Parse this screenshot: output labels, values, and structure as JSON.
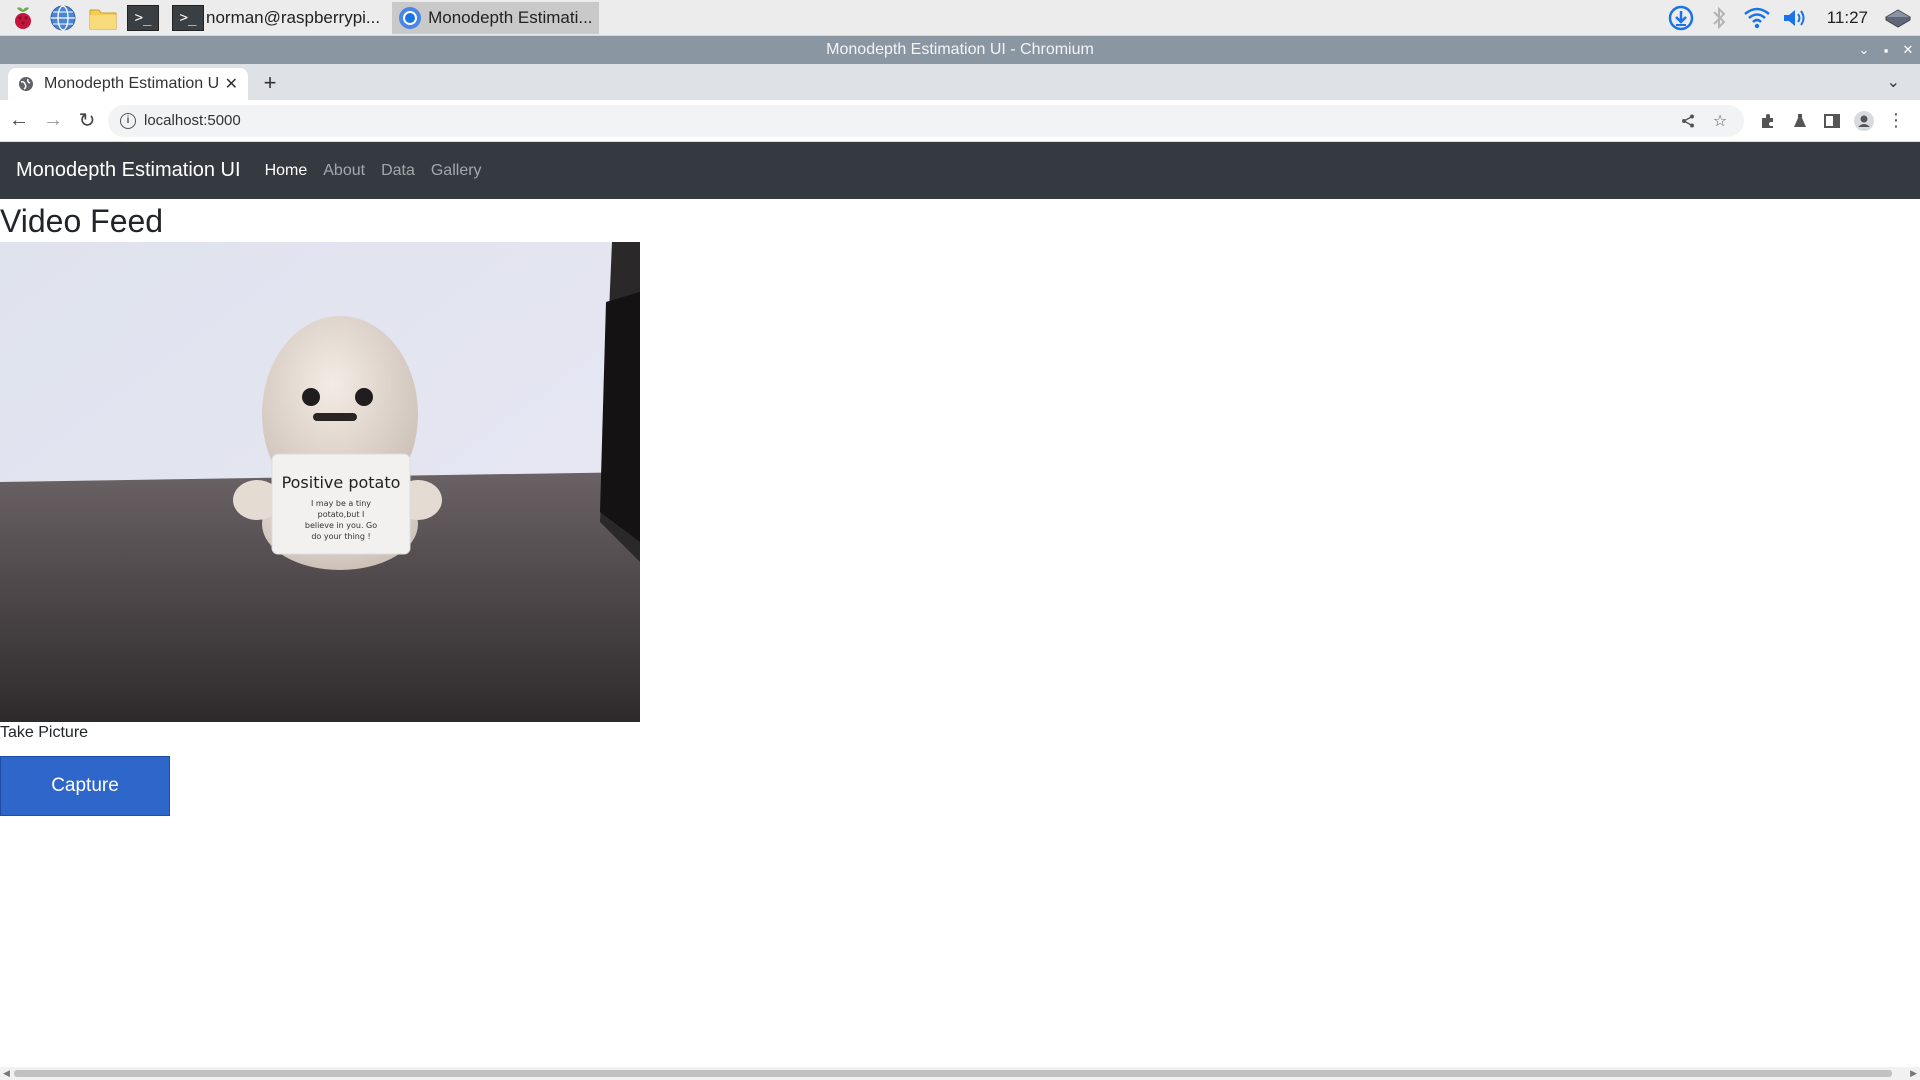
{
  "taskbar": {
    "tasks": [
      {
        "label": "norman@raspberrypi...",
        "icon": "terminal-icon"
      },
      {
        "label": "Monodepth Estimati...",
        "icon": "chromium-icon"
      }
    ],
    "clock": "11:27"
  },
  "window": {
    "title": "Monodepth Estimation UI - Chromium"
  },
  "browser": {
    "tab_title": "Monodepth Estimation UI",
    "url": "localhost:5000"
  },
  "page": {
    "brand": "Monodepth Estimation UI",
    "nav": [
      "Home",
      "About",
      "Data",
      "Gallery"
    ],
    "active_nav": "Home",
    "heading": "Video Feed",
    "feed": {
      "card_title": "Positive potato",
      "card_text": [
        "I may be a tiny",
        "potato,but I",
        "believe in you. Go",
        "do your thing !"
      ]
    },
    "take_picture_label": "Take Picture",
    "capture_button": "Capture"
  },
  "colors": {
    "navbar_bg": "#343a40",
    "button_bg": "#2f66c9",
    "window_title_bg": "#8b96a3"
  }
}
